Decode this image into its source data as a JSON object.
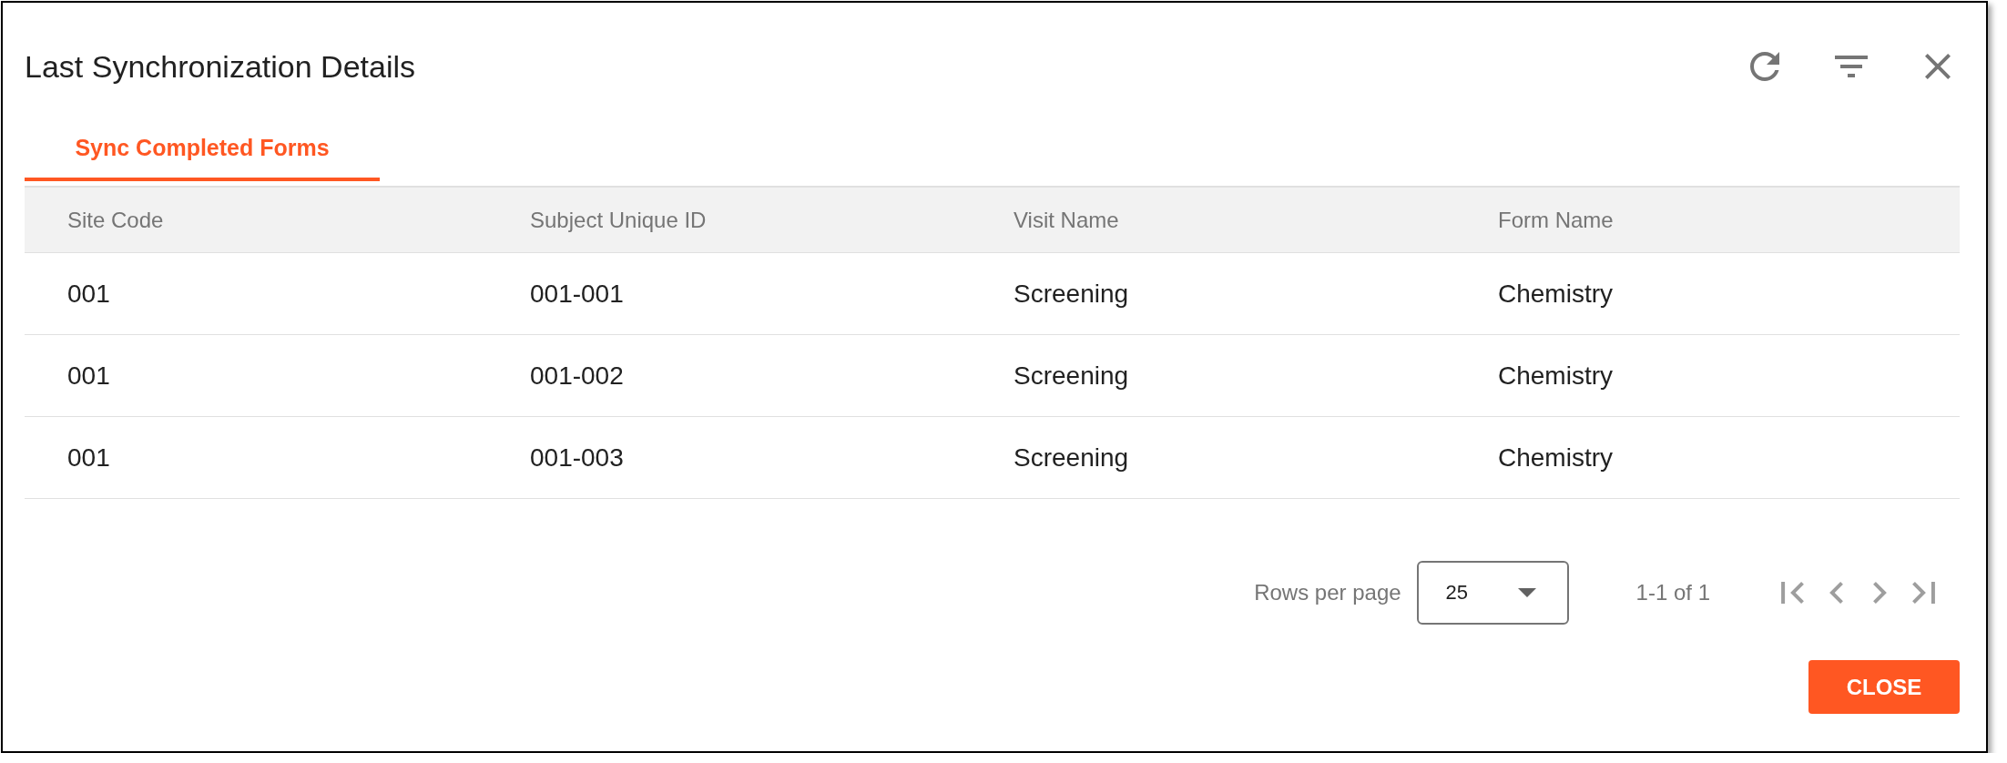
{
  "dialog": {
    "title": "Last Synchronization Details"
  },
  "tabs": [
    {
      "label": "Sync Completed Forms",
      "selected": true
    }
  ],
  "table": {
    "columns": [
      "Site Code",
      "Subject Unique ID",
      "Visit Name",
      "Form Name"
    ],
    "rows": [
      [
        "001",
        "001-001",
        "Screening",
        "Chemistry"
      ],
      [
        "001",
        "001-002",
        "Screening",
        "Chemistry"
      ],
      [
        "001",
        "001-003",
        "Screening",
        "Chemistry"
      ]
    ]
  },
  "pagination": {
    "rows_per_page_label": "Rows per page",
    "rows_per_page": "25",
    "range": "1-1 of 1",
    "nav_disabled": true
  },
  "actions": [
    "CLOSE"
  ]
}
